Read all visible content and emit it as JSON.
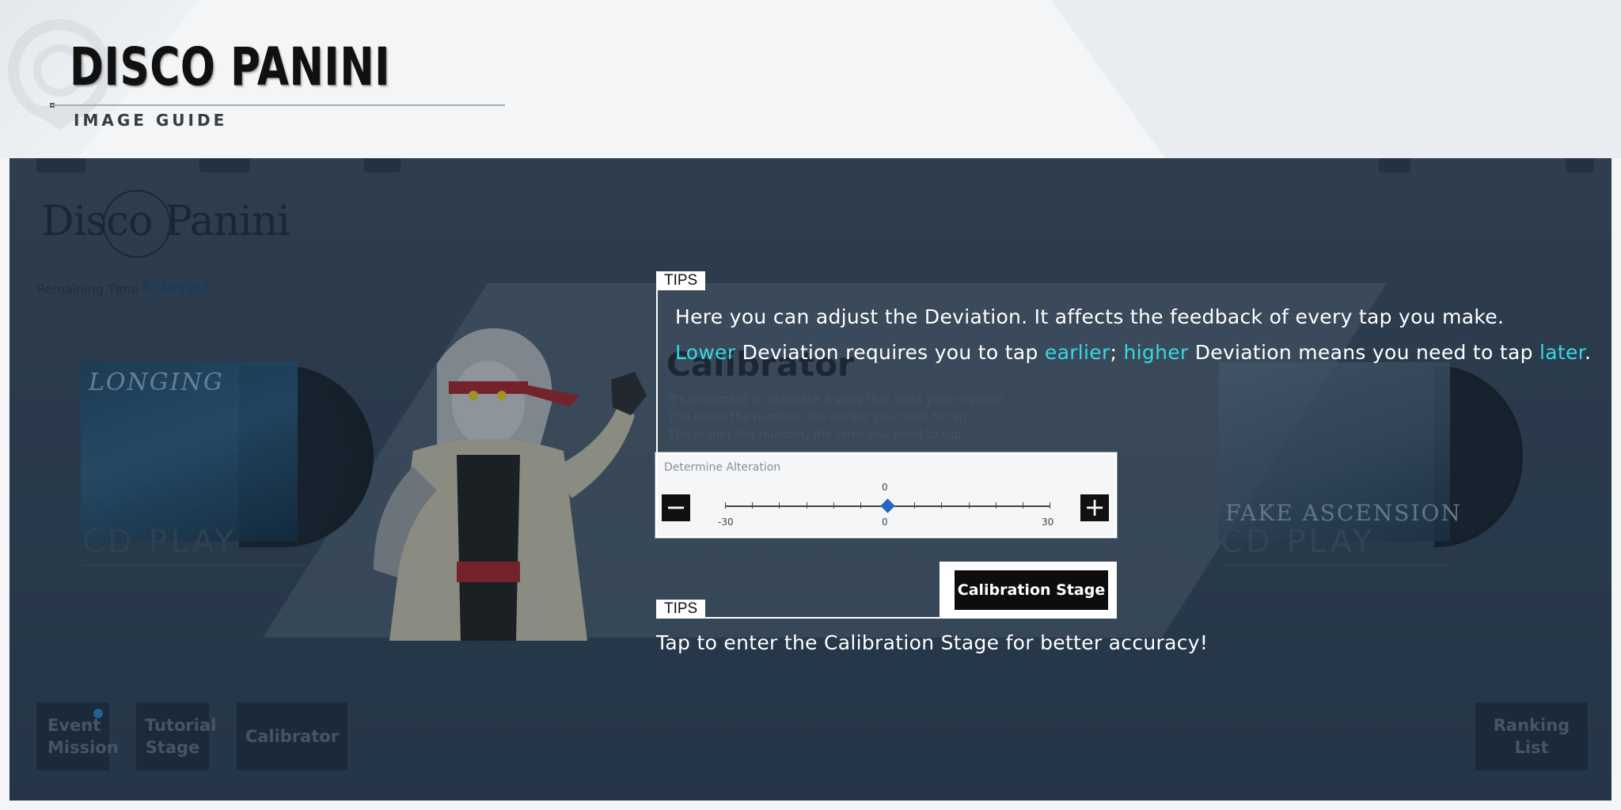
{
  "header": {
    "title": "DISCO PANINI",
    "subtitle": "IMAGE GUIDE"
  },
  "event": {
    "logo_text": "Disco Panini",
    "remaining_label": "Remaining Time",
    "remaining_value": "8 day(s)"
  },
  "albums": {
    "left": {
      "title": "LONGING",
      "cd_label": "CD PLAY"
    },
    "right": {
      "title": "FAKE ASCENSION",
      "cd_label": "CD PLAY"
    }
  },
  "calibrator": {
    "title": "Calibrator",
    "desc_lines": [
      "It's important to calibrate a song that suits your rhythm!",
      "The lower the number, the earlier you need to tap.",
      "The higher the number, the later you need to tap."
    ],
    "slider_label": "Determine Alteration",
    "value": 0,
    "min": -30,
    "max": 30,
    "value_label": "0",
    "min_label": "-30",
    "center_label": "0",
    "max_label": "30",
    "minus_symbol": "−",
    "plus_symbol": "+",
    "stage_button": "Calibration Stage"
  },
  "tips": {
    "tag": "TIPS",
    "first_line": "Here you can adjust the Deviation. It affects the feedback of every tap you make.",
    "second_line": {
      "lower": "Lower",
      "part1": " Deviation requires you to tap ",
      "earlier": "earlier",
      "sep": "; ",
      "higher": "higher",
      "part2": " Deviation means you need to tap ",
      "later": "later",
      "end": "."
    },
    "stage_tip": "Tap to enter the Calibration Stage for better accuracy!"
  },
  "bottom_buttons": {
    "event_mission": "Event Mission",
    "tutorial_stage": "Tutorial Stage",
    "calibrator": "Calibrator",
    "ranking_list": "Ranking List"
  },
  "colors": {
    "highlight": "#37d8e3",
    "slider_thumb": "#2566c0",
    "panel_bg": "#35475a"
  }
}
